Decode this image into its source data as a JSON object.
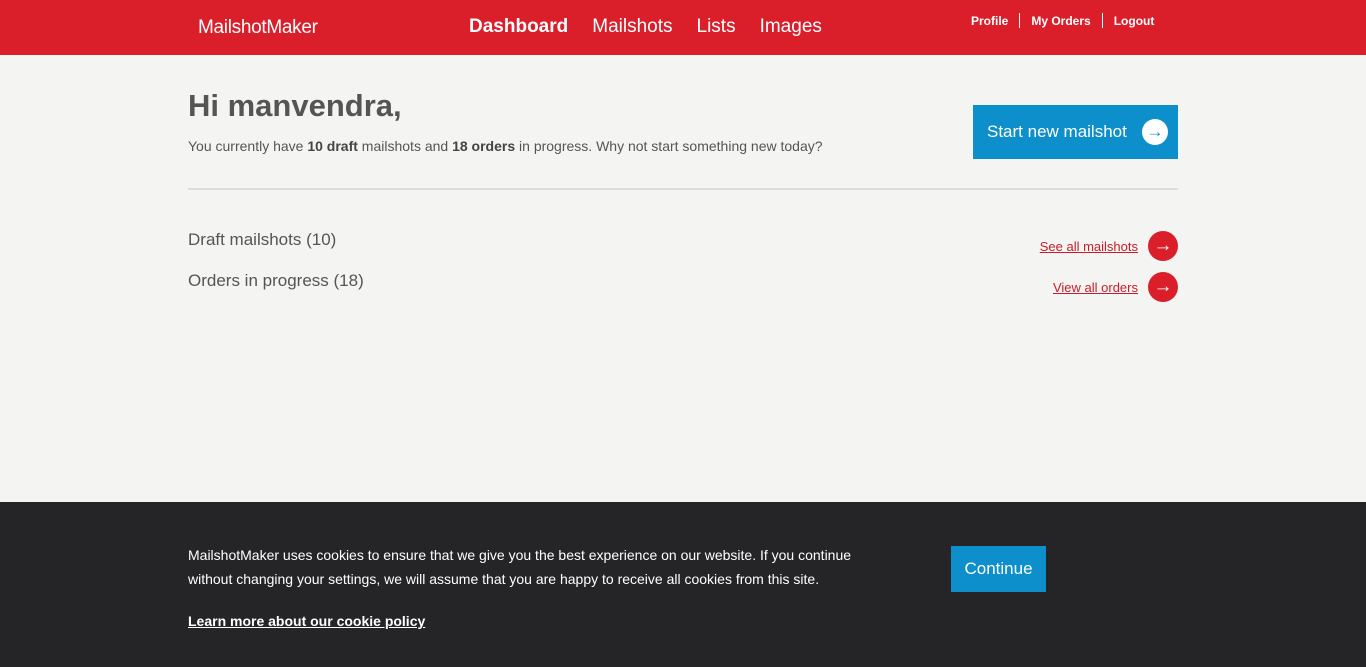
{
  "header": {
    "logo": "MailshotMaker",
    "nav": [
      "Dashboard",
      "Mailshots",
      "Lists",
      "Images"
    ],
    "user_links": [
      "Profile",
      "My Orders",
      "Logout"
    ]
  },
  "dashboard": {
    "greeting": "Hi manvendra,",
    "intro": {
      "prefix": "You currently have ",
      "draft_count": "10 draft",
      "middle": " mailshots and ",
      "order_count": "18 orders",
      "suffix": " in progress. Why not start something new today?"
    },
    "start_button": "Start new mailshot",
    "sections": [
      {
        "title": "Draft mailshots (10)",
        "link": "See all mailshots"
      },
      {
        "title": "Orders in progress (18)",
        "link": "View all orders"
      }
    ]
  },
  "cookie_banner": {
    "text": "MailshotMaker uses cookies to ensure that we give you the best experience on our website. If you continue without changing your settings, we will assume that you are happy to receive all cookies from this site.",
    "policy_link": "Learn more about our cookie policy",
    "continue": "Continue"
  },
  "icons": {
    "arrow": "arrow-right-icon"
  },
  "colors": {
    "brand_red": "#da1f2b",
    "accent_blue": "#0d8fcb",
    "banner_bg": "#252528"
  }
}
